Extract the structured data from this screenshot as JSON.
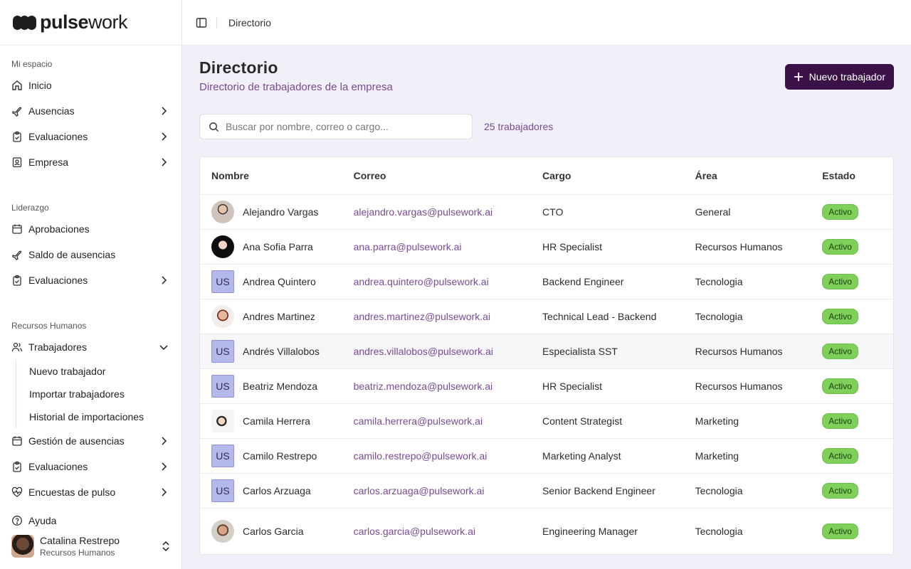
{
  "brand": {
    "bold": "pulse",
    "light": "work"
  },
  "sidebar": {
    "sections": [
      {
        "label": "Mi espacio"
      },
      {
        "label": "Liderazgo"
      },
      {
        "label": "Recursos Humanos"
      }
    ],
    "mi_espacio": [
      "Inicio",
      "Ausencias",
      "Evaluaciones",
      "Empresa"
    ],
    "liderazgo": [
      "Aprobaciones",
      "Saldo de ausencias",
      "Evaluaciones"
    ],
    "rrhh": {
      "trabajadores": "Trabajadores",
      "sub": [
        "Nuevo trabajador",
        "Importar trabajadores",
        "Historial de importaciones"
      ],
      "rest": [
        "Gestión de ausencias",
        "Evaluaciones",
        "Encuestas de pulso"
      ]
    },
    "help": "Ayuda",
    "user": {
      "name": "Catalina Restrepo",
      "role": "Recursos Humanos"
    }
  },
  "topbar": {
    "breadcrumb": "Directorio"
  },
  "page": {
    "title": "Directorio",
    "subtitle": "Directorio de trabajadores de la empresa",
    "new_button": "Nuevo trabajador",
    "search_placeholder": "Buscar por nombre, correo o cargo...",
    "count": "25 trabajadores"
  },
  "table": {
    "headers": [
      "Nombre",
      "Correo",
      "Cargo",
      "Área",
      "Estado"
    ],
    "rows": [
      {
        "avatar": "photo",
        "initials": "",
        "name": "Alejandro Vargas",
        "email": "alejandro.vargas@pulsework.ai",
        "role": "CTO",
        "area": "General",
        "status": "Activo"
      },
      {
        "avatar": "photo",
        "initials": "",
        "name": "Ana Sofia Parra",
        "email": "ana.parra@pulsework.ai",
        "role": "HR Specialist",
        "area": "Recursos Humanos",
        "status": "Activo"
      },
      {
        "avatar": "initials",
        "initials": "US",
        "name": "Andrea Quintero",
        "email": "andrea.quintero@pulsework.ai",
        "role": "Backend Engineer",
        "area": "Tecnologia",
        "status": "Activo"
      },
      {
        "avatar": "photo",
        "initials": "",
        "name": "Andres Martinez",
        "email": "andres.martinez@pulsework.ai",
        "role": "Technical Lead - Backend",
        "area": "Tecnologia",
        "status": "Activo"
      },
      {
        "avatar": "initials",
        "initials": "US",
        "name": "Andrés Villalobos",
        "email": "andres.villalobos@pulsework.ai",
        "role": "Especialista SST",
        "area": "Recursos Humanos",
        "status": "Activo"
      },
      {
        "avatar": "initials",
        "initials": "US",
        "name": "Beatriz Mendoza",
        "email": "beatriz.mendoza@pulsework.ai",
        "role": "HR Specialist",
        "area": "Recursos Humanos",
        "status": "Activo"
      },
      {
        "avatar": "photo",
        "initials": "",
        "name": "Camila Herrera",
        "email": "camila.herrera@pulsework.ai",
        "role": "Content Strategist",
        "area": "Marketing",
        "status": "Activo"
      },
      {
        "avatar": "initials",
        "initials": "US",
        "name": "Camilo Restrepo",
        "email": "camilo.restrepo@pulsework.ai",
        "role": "Marketing Analyst",
        "area": "Marketing",
        "status": "Activo"
      },
      {
        "avatar": "initials",
        "initials": "US",
        "name": "Carlos Arzuaga",
        "email": "carlos.arzuaga@pulsework.ai",
        "role": "Senior Backend Engineer",
        "area": "Tecnologia",
        "status": "Activo"
      },
      {
        "avatar": "photo",
        "initials": "",
        "name": "Carlos Garcia",
        "email": "carlos.garcia@pulsework.ai",
        "role": "Engineering Manager",
        "area": "Tecnologia",
        "status": "Activo"
      }
    ]
  },
  "colors": {
    "accent": "#3a1247",
    "link": "#7b4a94",
    "status_active": "#7ed05a"
  }
}
